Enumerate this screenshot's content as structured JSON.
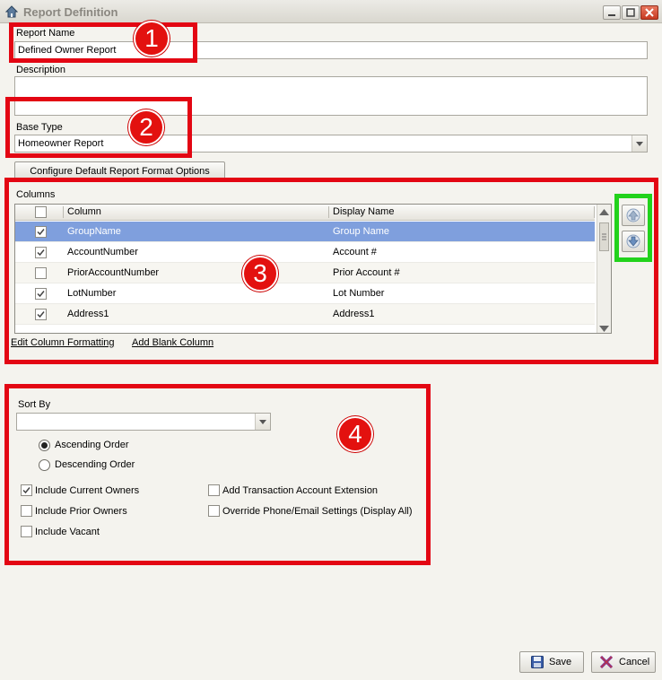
{
  "window": {
    "title": "Report Definition"
  },
  "fields": {
    "report_name_label": "Report Name",
    "report_name_value": "Defined Owner Report",
    "description_label": "Description",
    "description_value": "",
    "base_type_label": "Base Type",
    "base_type_value": "Homeowner Report",
    "configure_button": "Configure Default Report Format Options"
  },
  "columns": {
    "label": "Columns",
    "header_column": "Column",
    "header_display": "Display Name",
    "rows": [
      {
        "column": "GroupName",
        "display": "Group Name",
        "checked": true
      },
      {
        "column": "AccountNumber",
        "display": "Account #",
        "checked": true
      },
      {
        "column": "PriorAccountNumber",
        "display": "Prior Account #",
        "checked": false
      },
      {
        "column": "LotNumber",
        "display": "Lot Number",
        "checked": true
      },
      {
        "column": "Address1",
        "display": "Address1",
        "checked": true
      }
    ],
    "edit_formatting_link": "Edit Column Formatting",
    "add_blank_link": "Add Blank Column"
  },
  "sort": {
    "label": "Sort By",
    "value": "",
    "ascending": "Ascending Order",
    "descending": "Descending Order"
  },
  "options": {
    "include_current": "Include Current Owners",
    "include_prior": "Include Prior Owners",
    "include_vacant": "Include Vacant",
    "add_transaction": "Add Transaction Account Extension",
    "override_phone": "Override Phone/Email Settings (Display All)"
  },
  "footer": {
    "save": "Save",
    "cancel": "Cancel"
  },
  "annotations": [
    "1",
    "2",
    "3",
    "4"
  ],
  "colors": {
    "annotation_red": "#e30613",
    "annotation_green": "#22d21c",
    "selected_row": "#7f9fdd"
  }
}
